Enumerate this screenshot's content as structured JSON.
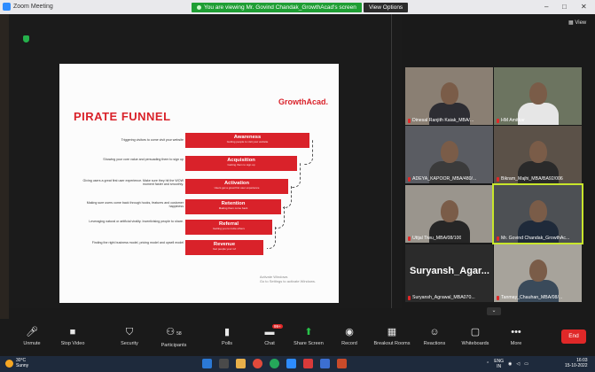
{
  "window": {
    "app_title": "Zoom Meeting",
    "share_banner": "You are viewing Mr. Govind Chandak_GrowthAcad's screen",
    "view_options": "View Options",
    "controls": [
      "–",
      "□",
      "✕"
    ]
  },
  "gallery_view_label": "View",
  "slide": {
    "brand": "GrowthAcad.",
    "title": "PIRATE FUNNEL",
    "rows": [
      {
        "desc": "Triggering visitors to come visit your website",
        "stage": "Awareness",
        "sub": "Getting people to visit your website"
      },
      {
        "desc": "Showing your core value and persuading them to sign up",
        "stage": "Acquisition",
        "sub": "Getting them to sign up"
      },
      {
        "desc": "Giving users a great first user experience. Make sure they hit the WOW moment faster and smoothly.",
        "stage": "Activation",
        "sub": "Users get a great first user experience"
      },
      {
        "desc": "Making sure users come back through hooks, features and customer happiness",
        "stage": "Retention",
        "sub": "Making them come back"
      },
      {
        "desc": "Leveraging natural or artificial virality. Incentivising people to share.",
        "stage": "Referral",
        "sub": "Getting you to invite others"
      },
      {
        "desc": "Finding the right business model, pricing model and upsell model",
        "stage": "Revenue",
        "sub": "Get people your ref"
      }
    ],
    "watermark_line1": "Activate Windows",
    "watermark_line2": "Go to Settings to activate Windows."
  },
  "participants": [
    {
      "name": "Dinesal Ranjith Kaiak_MBA/...",
      "active": false
    },
    {
      "name": "HM Amitkar",
      "active": false
    },
    {
      "name": "ADEYA_KAPOOR_MBA/480/...",
      "active": false
    },
    {
      "name": "Bikram_Majhi_MBA/BA92/006",
      "active": false
    },
    {
      "name": "Uttjal Tiwu_MBA/08/100",
      "active": false
    },
    {
      "name": "Mr. Govind Chandak_GrowthAc...",
      "active": true
    },
    {
      "name": "Suryansh_Agrawal_MBA070...",
      "active": false,
      "big_name": "Suryansh_Agar..."
    },
    {
      "name": "Tanmay_Chauhan_MBA/08/...",
      "active": false
    }
  ],
  "toolbar": {
    "items": [
      {
        "label": "Unmute",
        "icon": "mic-muted-icon"
      },
      {
        "label": "Stop Video",
        "icon": "video-icon"
      },
      {
        "label": "Security",
        "icon": "shield-icon"
      },
      {
        "label": "Participants",
        "icon": "participants-icon",
        "count": "58"
      },
      {
        "label": "Polls",
        "icon": "polls-icon"
      },
      {
        "label": "Chat",
        "icon": "chat-icon",
        "badge": "99+"
      },
      {
        "label": "Share Screen",
        "icon": "share-screen-icon"
      },
      {
        "label": "Record",
        "icon": "record-icon"
      },
      {
        "label": "Breakout Rooms",
        "icon": "breakout-icon"
      },
      {
        "label": "Reactions",
        "icon": "reactions-icon"
      },
      {
        "label": "Whiteboards",
        "icon": "whiteboard-icon"
      },
      {
        "label": "More",
        "icon": "more-icon"
      }
    ],
    "end_label": "End"
  },
  "taskbar": {
    "temp": "30°C",
    "weather": "Sunny",
    "lang": "ENG",
    "lang2": "IN",
    "time": "16:03",
    "date": "15-10-2022"
  }
}
